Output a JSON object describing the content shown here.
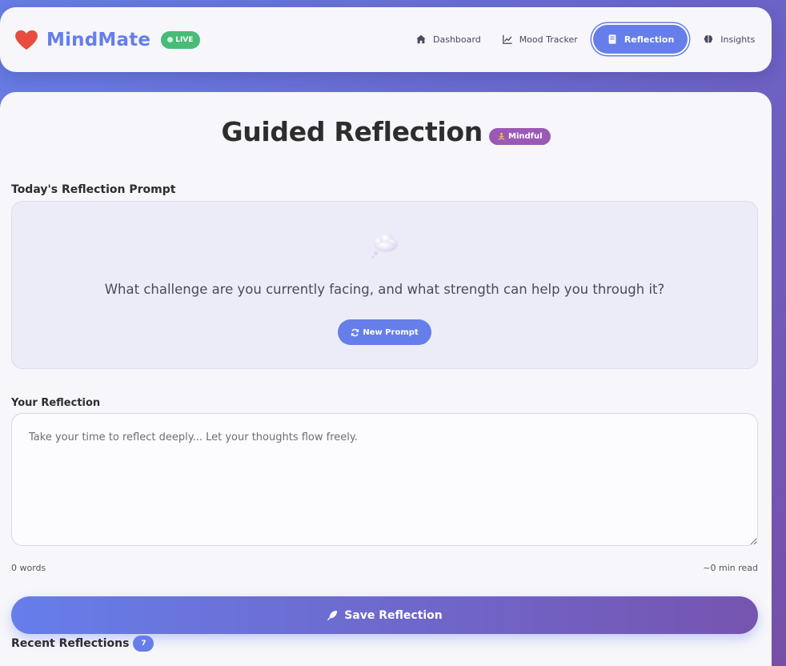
{
  "app": {
    "brand_name": "MindMate",
    "live_label": "LIVE",
    "heart_icon": "heart-icon",
    "colors": {
      "accent": "#667eea",
      "live": "#48bb78",
      "heart": "#e74c3c",
      "mindful": "#9b59b6",
      "text": "#2d2d2d"
    }
  },
  "nav": {
    "items": [
      {
        "label": "Dashboard",
        "icon": "home-icon",
        "active": false
      },
      {
        "label": "Mood Tracker",
        "icon": "chart-line-icon",
        "active": false
      },
      {
        "label": "Reflection",
        "icon": "book-icon",
        "active": true
      },
      {
        "label": "Insights",
        "icon": "brain-icon",
        "active": false
      }
    ]
  },
  "page": {
    "title": "Guided Reflection",
    "badge_label": "Mindful",
    "badge_icon": "meditation-icon"
  },
  "prompt": {
    "section_label": "Today's Reflection Prompt",
    "icon": "thought-bubble-icon",
    "text": "What challenge are you currently facing, and what strength can help you through it?",
    "new_prompt_label": "New Prompt",
    "new_prompt_icon": "refresh-icon"
  },
  "reflection": {
    "section_label": "Your Reflection",
    "placeholder": "Take your time to reflect deeply... Let your thoughts flow freely.",
    "value": "",
    "word_count": "0 words",
    "read_time": "~0 min read",
    "save_label": "Save Reflection",
    "save_icon": "feather-icon"
  },
  "recent": {
    "title": "Recent Reflections",
    "count": "7"
  }
}
